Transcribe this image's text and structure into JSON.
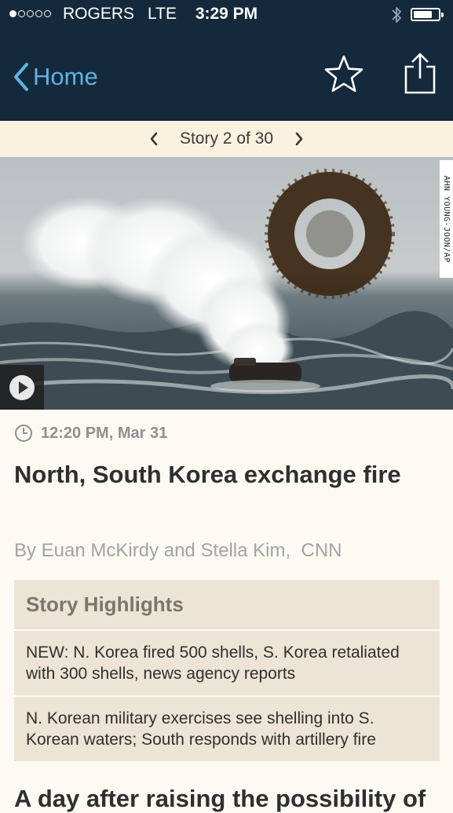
{
  "status_bar": {
    "carrier": "ROGERS",
    "network": "LTE",
    "time": "3:29 PM",
    "signal_bars": 1,
    "signal_total": 5,
    "bluetooth_icon": "bluetooth-icon",
    "battery_level": 0.75
  },
  "nav": {
    "back_label": "Home",
    "favorite_icon": "star-outline-icon",
    "share_icon": "share-icon"
  },
  "story_nav": {
    "label": "Story 2 of 30",
    "prev_icon": "chevron-left-icon",
    "next_icon": "chevron-right-icon"
  },
  "hero": {
    "photo_credit": "AHN YOUNG-JOON/AP",
    "play_icon": "play-icon"
  },
  "article": {
    "timestamp": "12:20 PM, Mar 31",
    "headline": "North, South Korea exchange fire",
    "byline": "By Euan McKirdy and Stella Kim,  CNN",
    "highlights_title": "Story Highlights",
    "highlights": [
      "NEW: N. Korea fired 500 shells, S. Korea retaliated with 300 shells, news agency reports",
      "N. Korean military exercises see shelling into S. Korean waters; South responds with artillery fire"
    ],
    "body_start": "A day after raising the possibility of"
  },
  "colors": {
    "nav_bg": "#14293c",
    "accent": "#5fb2e2",
    "story_nav_bg": "#fbf1df",
    "highlights_bg": "#ece5d5"
  }
}
